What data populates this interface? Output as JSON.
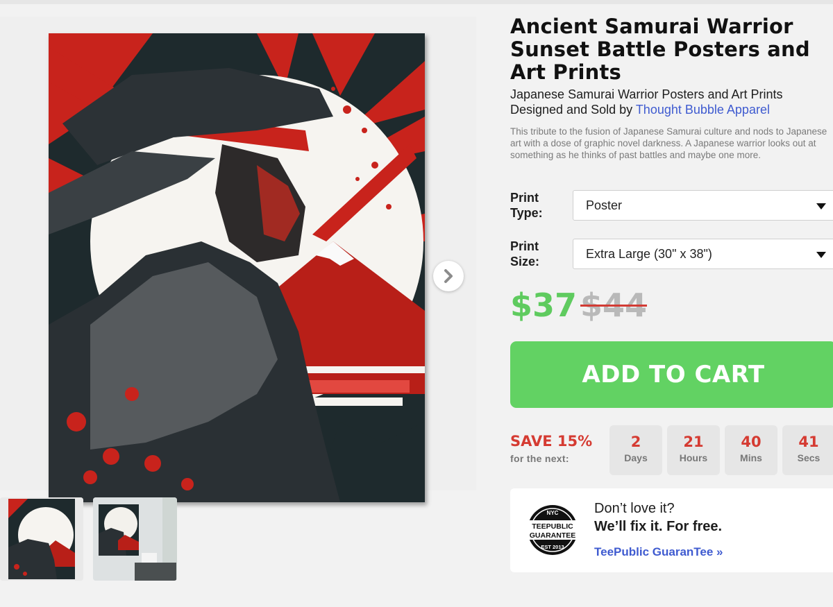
{
  "product": {
    "title": "Ancient Samurai Warrior Sunset Battle Posters and Art Prints",
    "subtitle": "Japanese Samurai Warrior Posters and Art Prints",
    "designed_by_prefix": "Designed and Sold by ",
    "designer": "Thought Bubble Apparel",
    "description": "This tribute to the fusion of Japanese Samurai culture and nods to Japanese art with a dose of graphic novel darkness. A Japanese warrior looks out at something as he thinks of past battles and maybe one more."
  },
  "options": {
    "print_type": {
      "label": "Print Type:",
      "value": "Poster"
    },
    "print_size": {
      "label": "Print Size:",
      "value": "Extra Large (30\" x 38\")"
    }
  },
  "pricing": {
    "price": "$37",
    "original_price": "$44"
  },
  "cart": {
    "add_label": "ADD TO CART"
  },
  "sale": {
    "title": "SAVE 15%",
    "subtitle": "for the next:",
    "countdown": [
      {
        "value": "2",
        "unit": "Days"
      },
      {
        "value": "21",
        "unit": "Hours"
      },
      {
        "value": "40",
        "unit": "Mins"
      },
      {
        "value": "41",
        "unit": "Secs"
      }
    ]
  },
  "guarantee": {
    "line1": "Don’t love it?",
    "line2": "We’ll fix it. For free.",
    "link": "TeePublic GuaranTee »",
    "badge": {
      "top": "NYC",
      "mid1": "TEEPUBLIC",
      "mid2": "GUARANTEE",
      "bottom": "EST 2013"
    }
  },
  "gallery": {
    "next_icon": "chevron-right-icon",
    "thumbnail_count": 2
  },
  "colors": {
    "price_green": "#5fcb5f",
    "cart_green": "#62d263",
    "sale_red": "#d53b32",
    "link_blue": "#3f5bd0",
    "art_red": "#c8231c",
    "art_dark": "#1e2a2d"
  }
}
